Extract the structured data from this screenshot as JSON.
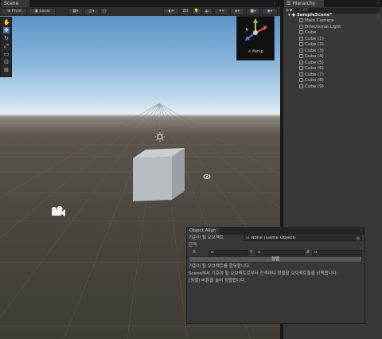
{
  "scene": {
    "tab_label": "Scene",
    "pivot_label": "Pivot",
    "local_label": "Local",
    "toolbar_2d": "2D",
    "persp_label": "< Persp"
  },
  "hierarchy": {
    "tab_label": "Hierarchy",
    "search_placeholder": "All",
    "scene_name": "SampleScene*",
    "items": [
      {
        "label": "Main Camera"
      },
      {
        "label": "Directional Light"
      },
      {
        "label": "Cube"
      },
      {
        "label": "Cube (1)"
      },
      {
        "label": "Cube (2)"
      },
      {
        "label": "Cube (3)"
      },
      {
        "label": "Cube (4)"
      },
      {
        "label": "Cube (5)"
      },
      {
        "label": "Cube (6)"
      },
      {
        "label": "Cube (7)"
      },
      {
        "label": "Cube (8)"
      },
      {
        "label": "Cube (9)"
      }
    ]
  },
  "object_align": {
    "tab_label": "Object Align",
    "reference_label": "기준이 될 오브젝트",
    "reference_value": "None (Game Object)",
    "spacing_label": "간격",
    "x_label": "X",
    "x_value": "0",
    "y_label": "Y",
    "y_value": "0",
    "z_label": "Z",
    "z_value": "0",
    "align_button": "정렬",
    "help_lines": [
      "기준이 될 오브젝트를 할당합니다.",
      "Scene에서 기준이 될 오브젝트로부터 간격마다 정렬할 오브젝트들을 선택합니다.",
      "[정렬] 버튼을 눌러 정렬합니다."
    ]
  },
  "colors": {
    "panel": "#383838",
    "accent_selected": "#3d6ea6"
  }
}
